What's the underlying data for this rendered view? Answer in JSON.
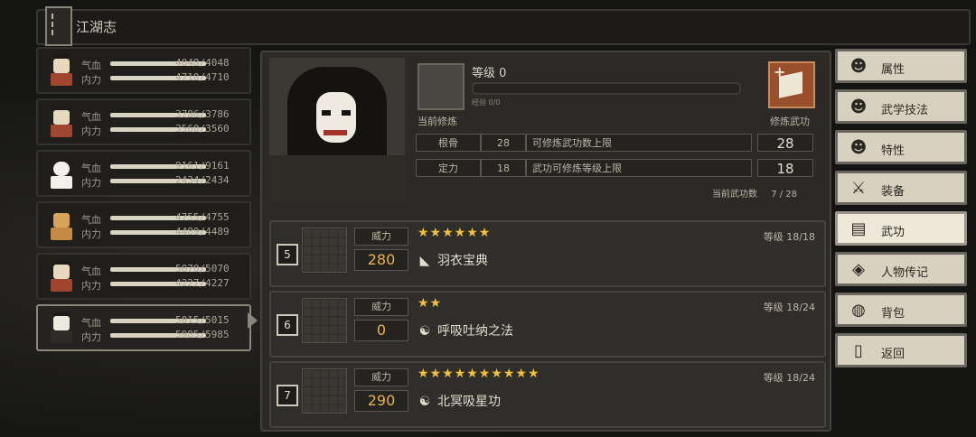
{
  "title": "江湖志",
  "roster": [
    {
      "hp_label": "气血",
      "hp": "4048/4048",
      "mp_label": "内力",
      "mp": "4710/4710"
    },
    {
      "hp_label": "气血",
      "hp": "3786/3786",
      "mp_label": "内力",
      "mp": "3560/3560"
    },
    {
      "hp_label": "气血",
      "hp": "9161/9161",
      "mp_label": "内力",
      "mp": "2434/2434"
    },
    {
      "hp_label": "气血",
      "hp": "4755/4755",
      "mp_label": "内力",
      "mp": "4489/4489"
    },
    {
      "hp_label": "气血",
      "hp": "5070/5070",
      "mp_label": "内力",
      "mp": "4227/4227"
    },
    {
      "hp_label": "气血",
      "hp": "5015/5015",
      "mp_label": "内力",
      "mp": "5985/5985"
    }
  ],
  "panel": {
    "level_label": "等级 0",
    "xp_label": "经验 0/0",
    "current_training": "当前修炼",
    "train_skill": "修炼武功",
    "stats": [
      {
        "name": "根骨",
        "value": "28",
        "desc": "可修炼武功数上限",
        "cap": "28"
      },
      {
        "name": "定力",
        "value": "18",
        "desc": "武功可修炼等级上限",
        "cap": "18"
      }
    ],
    "count_label": "当前武功数",
    "count_value": "7 / 28"
  },
  "skills": [
    {
      "index": "5",
      "power_label": "威力",
      "power": "280",
      "stars": "★★★★★★",
      "icon": "◣",
      "name": "羽衣宝典",
      "level": "等级 18/18"
    },
    {
      "index": "6",
      "power_label": "威力",
      "power": "0",
      "stars": "★★",
      "icon": "☯",
      "name": "呼吸吐纳之法",
      "level": "等级 18/24"
    },
    {
      "index": "7",
      "power_label": "威力",
      "power": "290",
      "stars": "★★★★★★★★★★",
      "icon": "☯",
      "name": "北冥吸星功",
      "level": "等级 18/24"
    }
  ],
  "menu": [
    {
      "label": "属性",
      "icon": "☻"
    },
    {
      "label": "武学技法",
      "icon": "☻"
    },
    {
      "label": "特性",
      "icon": "☻"
    },
    {
      "label": "装备",
      "icon": "⚔"
    },
    {
      "label": "武功",
      "icon": "▤"
    },
    {
      "label": "人物传记",
      "icon": "◈"
    },
    {
      "label": "背包",
      "icon": "◍"
    },
    {
      "label": "返回",
      "icon": "▯"
    }
  ],
  "colors": {
    "accent": "#e8b34a",
    "star": "#f0c23a",
    "menu_bg": "#d8d1bf"
  }
}
